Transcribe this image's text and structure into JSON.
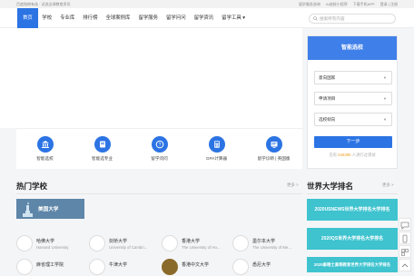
{
  "topbar": {
    "left_text": "百度指南有选 · 试选全球教育资讯",
    "links": [
      "留学服务咨询",
      "AI选校小程序",
      "下载手机APP",
      "登录 | 注册"
    ]
  },
  "nav": {
    "items": [
      "首页",
      "学校",
      "专业库",
      "排行榜",
      "全球案例库",
      "留学服务",
      "留学问问",
      "留学资讯",
      "留学工具"
    ],
    "active_index": 0,
    "tools_suffix": "▾",
    "search_placeholder": "搜索所有内容"
  },
  "quick_links": [
    {
      "label": "智能选校",
      "icon": "school-icon"
    },
    {
      "label": "智能选专业",
      "icon": "book-icon"
    },
    {
      "label": "留学问问",
      "icon": "question-icon"
    },
    {
      "label": "GPA计算器",
      "icon": "calculator-icon"
    },
    {
      "label": "留学诊断 | 英国版",
      "icon": "diagnosis-icon"
    }
  ],
  "selector": {
    "title": "智能选校",
    "country_placeholder": "意向国家",
    "program_placeholder": "申请项目",
    "tendency_placeholder": "选校倾向",
    "submit_label": "下一步",
    "count_prefix": "已有 ",
    "count_value": "546395",
    "count_suffix": " 人进行过测试"
  },
  "hot_schools": {
    "title": "热门学校",
    "more": "更多 >",
    "tab_label": "美国大学",
    "schools": [
      {
        "name": "哈佛大学",
        "en": "Harvard University"
      },
      {
        "name": "剑桥大学",
        "en": "University of Cambri..."
      },
      {
        "name": "香港大学",
        "en": "The University of Ho..."
      },
      {
        "name": "墨尔本大学",
        "en": "The University of Me..."
      },
      {
        "name": "麻省理工学院",
        "en": ""
      },
      {
        "name": "牛津大学",
        "en": ""
      },
      {
        "name": "香港中文大学",
        "en": ""
      },
      {
        "name": "悉尼大学",
        "en": ""
      }
    ]
  },
  "world_rankings": {
    "title": "世界大学排名",
    "more": "更多 >",
    "items": [
      "2020USNEWS世界大学排名大学排名",
      "2020QS世界大学排名大学排名",
      "2020泰晤士高等教育世界大学排名大学排名"
    ]
  },
  "colors": {
    "primary": "#2c74e4",
    "ranking": "#3ec3cf",
    "accent": "#f0a020"
  }
}
